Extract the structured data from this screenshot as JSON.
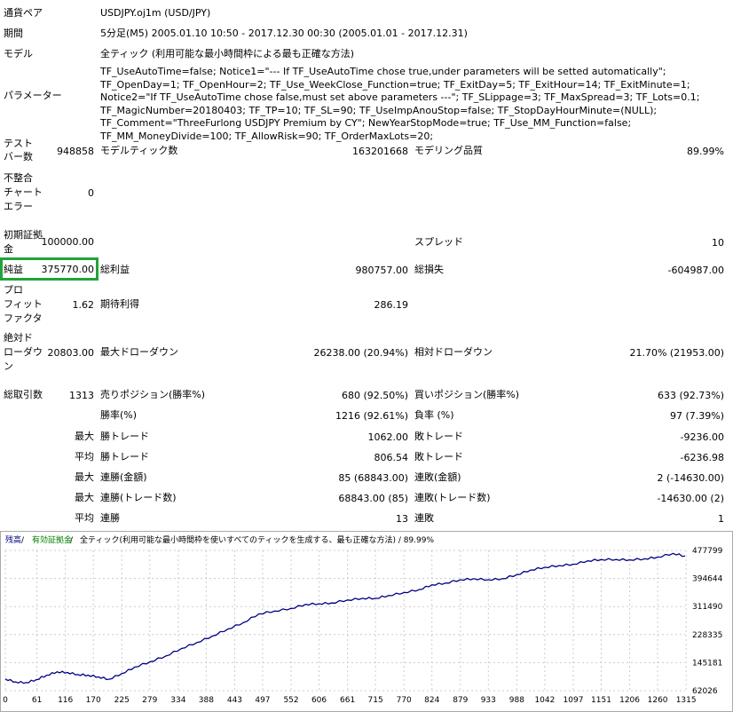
{
  "report": {
    "symbol_label": "通貨ペア",
    "symbol_value": "USDJPY.oj1m (USD/JPY)",
    "period_label": "期間",
    "period_value": "5分足(M5) 2005.01.10 10:50 - 2017.12.30 00:30 (2005.01.01 - 2017.12.31)",
    "model_label": "モデル",
    "model_value": "全ティック (利用可能な最小時間枠による最も正確な方法)",
    "params_label": "パラメーター",
    "params_value": "TF_UseAutoTime=false; Notice1=\"--- If TF_UseAutoTime chose true,under parameters will be setted automatically\"; TF_OpenDay=1; TF_OpenHour=2; TF_Use_WeekClose_Function=true; TF_ExitDay=5; TF_ExitHour=14; TF_ExitMinute=1; Notice2=\"If TF_UseAutoTime chose false,must set above parameters ---\"; TF_SLippage=3; TF_MaxSpread=3; TF_Lots=0.1; TF_MagicNumber=20180403; TF_TP=10; TF_SL=90; TF_UseImpAnouStop=false; TF_StopDayHourMinute=(NULL); TF_Comment=\"ThreeFurlong USDJPY Premium by CY\"; NewYearStopMode=true; TF_Use_MM_Function=false; TF_MM_MoneyDivide=100; TF_AllowRisk=90; TF_OrderMaxLots=20;",
    "bars_label_1": "テスト",
    "bars_label_2": "バー数",
    "bars_value": "948858",
    "ticks_label": "モデルティック数",
    "ticks_value": "163201668",
    "quality_label": "モデリング品質",
    "quality_value": "89.99%",
    "mismatch_label_1": "不整合",
    "mismatch_label_2": "チャート",
    "mismatch_label_3": "エラー",
    "mismatch_value": "0",
    "deposit_label_1": "初期証拠",
    "deposit_label_2": "金",
    "deposit_value": "100000.00",
    "spread_label": "スプレッド",
    "spread_value": "10",
    "net_label": "純益",
    "net_value": "375770.00",
    "gross_profit_label": "総利益",
    "gross_profit_value": "980757.00",
    "gross_loss_label": "総損失",
    "gross_loss_value": "-604987.00",
    "pf_label_1": "プロ",
    "pf_label_2": "フィット",
    "pf_label_3": "ファクタ",
    "pf_value": "1.62",
    "expected_label": "期待利得",
    "expected_value": "286.19",
    "abs_dd_label_1": "絶対ド",
    "abs_dd_label_2": "ローダウ",
    "abs_dd_label_3": "ン",
    "abs_dd_value": "20803.00",
    "max_dd_label": "最大ドローダウン",
    "max_dd_value": "26238.00 (20.94%)",
    "rel_dd_label": "相対ドローダウン",
    "rel_dd_value": "21.70% (21953.00)",
    "trades_label": "総取引数",
    "trades_value": "1313",
    "short_label": "売りポジション(勝率%)",
    "short_value": "680 (92.50%)",
    "long_label": "買いポジション(勝率%)",
    "long_value": "633 (92.73%)",
    "win_rate_label": "勝率(%)",
    "win_rate_value": "1216 (92.61%)",
    "loss_rate_label": "負率 (%)",
    "loss_rate_value": "97 (7.39%)",
    "max_prefix": "最大",
    "avg_prefix": "平均",
    "largest_win_label": "勝トレード",
    "largest_win_value": "1062.00",
    "largest_loss_label": "敗トレード",
    "largest_loss_value": "-9236.00",
    "avg_win_label": "勝トレード",
    "avg_win_value": "806.54",
    "avg_loss_label": "敗トレード",
    "avg_loss_value": "-6236.98",
    "max_consec_win_label": "連勝(金額)",
    "max_consec_win_value": "85 (68843.00)",
    "max_consec_loss_label": "連敗(金額)",
    "max_consec_loss_value": "2 (-14630.00)",
    "max_consec_profit_label": "連勝(トレード数)",
    "max_consec_profit_value": "68843.00 (85)",
    "max_consec_lossamt_label": "連敗(トレード数)",
    "max_consec_lossamt_value": "-14630.00 (2)",
    "avg_consec_win_label": "連勝",
    "avg_consec_win_value": "13",
    "avg_consec_loss_label": "連敗",
    "avg_consec_loss_value": "1"
  },
  "chart_data": {
    "type": "line",
    "legend_balance": "残高",
    "legend_sep1": " / ",
    "legend_equity": "有効証拠金",
    "legend_sep2": " / ",
    "legend_text": "全ティック(利用可能な最小時間枠を使いすべてのティックを生成する、最も正確な方法) / 89.99%",
    "balance_color": "#000080",
    "equity_color": "#008000",
    "y_ticks": [
      "477799",
      "394644",
      "311490",
      "228335",
      "145181",
      "62026"
    ],
    "x_ticks": [
      "0",
      "61",
      "116",
      "170",
      "225",
      "279",
      "334",
      "388",
      "443",
      "497",
      "552",
      "606",
      "661",
      "715",
      "770",
      "824",
      "879",
      "933",
      "988",
      "1042",
      "1097",
      "1151",
      "1206",
      "1260",
      "1315"
    ],
    "ylim": [
      62026,
      477799
    ],
    "xlim": [
      0,
      1313
    ],
    "series": [
      {
        "values_x": [
          0,
          20,
          40,
          60,
          80,
          100,
          120,
          140,
          160,
          180,
          200,
          225,
          250,
          280,
          310,
          340,
          370,
          400,
          430,
          460,
          490,
          520,
          552,
          580,
          606,
          630,
          661,
          690,
          715,
          740,
          770,
          800,
          824,
          850,
          879,
          905,
          933,
          960,
          988,
          1015,
          1042,
          1070,
          1097,
          1125,
          1151,
          1180,
          1206,
          1235,
          1260,
          1290,
          1313
        ],
        "values_y": [
          97000,
          88000,
          86000,
          95000,
          108000,
          118000,
          116000,
          110000,
          108000,
          103000,
          96000,
          113000,
          132000,
          148000,
          165000,
          187000,
          205000,
          224000,
          245000,
          264000,
          290000,
          298000,
          306000,
          318000,
          320000,
          322000,
          331000,
          336000,
          336000,
          344000,
          353000,
          362000,
          376000,
          381000,
          391000,
          394000,
          391000,
          394000,
          406000,
          420000,
          428000,
          433000,
          437000,
          447000,
          451000,
          451000,
          450000,
          453000,
          458000,
          469000,
          461000
        ]
      }
    ]
  }
}
